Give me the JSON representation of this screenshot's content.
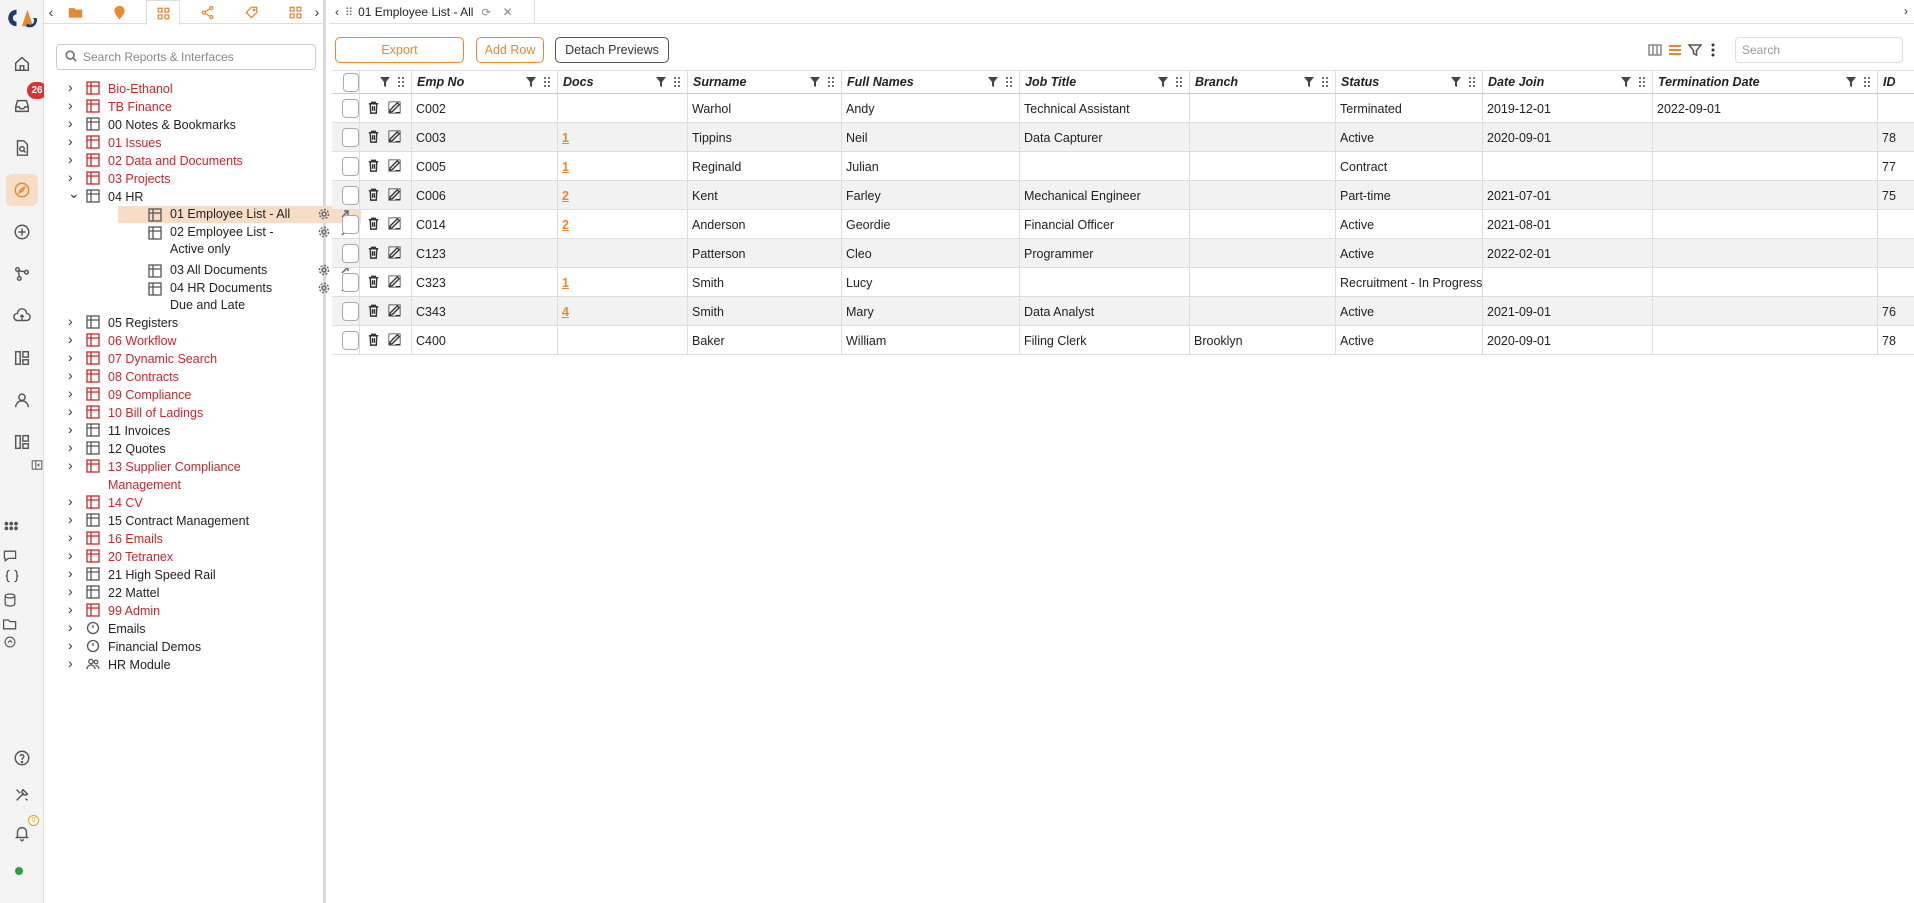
{
  "nav": {
    "search_placeholder": "Search Reports & Interfaces",
    "tree": [
      {
        "label": "Bio-Ethanol",
        "color": "red",
        "icon": "grid-icon"
      },
      {
        "label": "TB Finance",
        "color": "red",
        "icon": "grid-icon"
      },
      {
        "label": "00 Notes & Bookmarks",
        "color": "black",
        "icon": "grid-icon"
      },
      {
        "label": "01 Issues",
        "color": "red",
        "icon": "grid-icon"
      },
      {
        "label": "02 Data and Documents",
        "color": "red",
        "icon": "grid-icon"
      },
      {
        "label": "03 Projects",
        "color": "red",
        "icon": "grid-icon"
      },
      {
        "label": "04 HR",
        "color": "black",
        "icon": "grid-icon",
        "expanded": true
      },
      {
        "label": "05 Registers",
        "color": "black",
        "icon": "grid-icon"
      },
      {
        "label": "06 Workflow",
        "color": "red",
        "icon": "grid-icon"
      },
      {
        "label": "07 Dynamic Search",
        "color": "red",
        "icon": "grid-icon"
      },
      {
        "label": "08 Contracts",
        "color": "red",
        "icon": "grid-icon"
      },
      {
        "label": "09 Compliance",
        "color": "red",
        "icon": "grid-icon"
      },
      {
        "label": "10 Bill of Ladings",
        "color": "red",
        "icon": "grid-icon"
      },
      {
        "label": "11 Invoices",
        "color": "black",
        "icon": "grid-icon"
      },
      {
        "label": "12 Quotes",
        "color": "black",
        "icon": "grid-icon"
      },
      {
        "label": "13 Supplier Compliance Management",
        "color": "red",
        "icon": "grid-icon"
      },
      {
        "label": "14 CV",
        "color": "red",
        "icon": "grid-icon"
      },
      {
        "label": "15 Contract Management",
        "color": "black",
        "icon": "grid-icon"
      },
      {
        "label": "16 Emails",
        "color": "red",
        "icon": "grid-icon"
      },
      {
        "label": "20 Tetranex",
        "color": "red",
        "icon": "grid-icon"
      },
      {
        "label": "21 High Speed Rail",
        "color": "black",
        "icon": "grid-icon"
      },
      {
        "label": "22 Mattel",
        "color": "black",
        "icon": "grid-icon"
      },
      {
        "label": "99 Admin",
        "color": "red",
        "icon": "grid-icon"
      },
      {
        "label": "Emails",
        "color": "black",
        "icon": "circle-icon"
      },
      {
        "label": "Financial Demos",
        "color": "black",
        "icon": "circle-icon"
      },
      {
        "label": "HR Module",
        "color": "black",
        "icon": "people-icon"
      }
    ],
    "hr_children": [
      {
        "label": "01 Employee List - All",
        "selected": true
      },
      {
        "label": "02 Employee List - Active only"
      },
      {
        "label": "03 All Documents"
      },
      {
        "label": "04 HR Documents Due and Late"
      }
    ]
  },
  "rail": {
    "badge_count": "26",
    "notification_count": "0",
    "accent": "#e8892f"
  },
  "tab": {
    "title": "01 Employee List - All"
  },
  "toolbar": {
    "export_label": "Export",
    "add_row_label": "Add Row",
    "detach_label": "Detach Previews",
    "search_placeholder": "Search"
  },
  "table": {
    "columns": [
      "Emp No",
      "Docs",
      "Surname",
      "Full Names",
      "Job Title",
      "Branch",
      "Status",
      "Date Join",
      "Termination Date",
      "ID"
    ],
    "rows": [
      {
        "emp_no": "C002",
        "docs": "",
        "surname": "Warhol",
        "full_names": "Andy",
        "job_title": "Technical Assistant",
        "branch": "",
        "status": "Terminated",
        "date_join": "2019-12-01",
        "termination_date": "2022-09-01",
        "id": ""
      },
      {
        "emp_no": "C003",
        "docs": "1",
        "surname": "Tippins",
        "full_names": "Neil",
        "job_title": "Data Capturer",
        "branch": "",
        "status": "Active",
        "date_join": "2020-09-01",
        "termination_date": "",
        "id": "78"
      },
      {
        "emp_no": "C005",
        "docs": "1",
        "surname": "Reginald",
        "full_names": "Julian",
        "job_title": "",
        "branch": "",
        "status": "Contract",
        "date_join": "",
        "termination_date": "",
        "id": "77"
      },
      {
        "emp_no": "C006",
        "docs": "2",
        "surname": "Kent",
        "full_names": "Farley",
        "job_title": "Mechanical Engineer",
        "branch": "",
        "status": "Part-time",
        "date_join": "2021-07-01",
        "termination_date": "",
        "id": "75"
      },
      {
        "emp_no": "C014",
        "docs": "2",
        "surname": "Anderson",
        "full_names": "Geordie",
        "job_title": "Financial Officer",
        "branch": "",
        "status": "Active",
        "date_join": "2021-08-01",
        "termination_date": "",
        "id": ""
      },
      {
        "emp_no": "C123",
        "docs": "",
        "surname": "Patterson",
        "full_names": "Cleo",
        "job_title": "Programmer",
        "branch": "",
        "status": "Active",
        "date_join": "2022-02-01",
        "termination_date": "",
        "id": ""
      },
      {
        "emp_no": "C323",
        "docs": "1",
        "surname": "Smith",
        "full_names": "Lucy",
        "job_title": "",
        "branch": "",
        "status": "Recruitment - In Progress",
        "date_join": "",
        "termination_date": "",
        "id": ""
      },
      {
        "emp_no": "C343",
        "docs": "4",
        "surname": "Smith",
        "full_names": "Mary",
        "job_title": "Data Analyst",
        "branch": "",
        "status": "Active",
        "date_join": "2021-09-01",
        "termination_date": "",
        "id": "76"
      },
      {
        "emp_no": "C400",
        "docs": "",
        "surname": "Baker",
        "full_names": "William",
        "job_title": "Filing Clerk",
        "branch": "Brooklyn",
        "status": "Active",
        "date_join": "2020-09-01",
        "termination_date": "",
        "id": "78"
      }
    ]
  }
}
